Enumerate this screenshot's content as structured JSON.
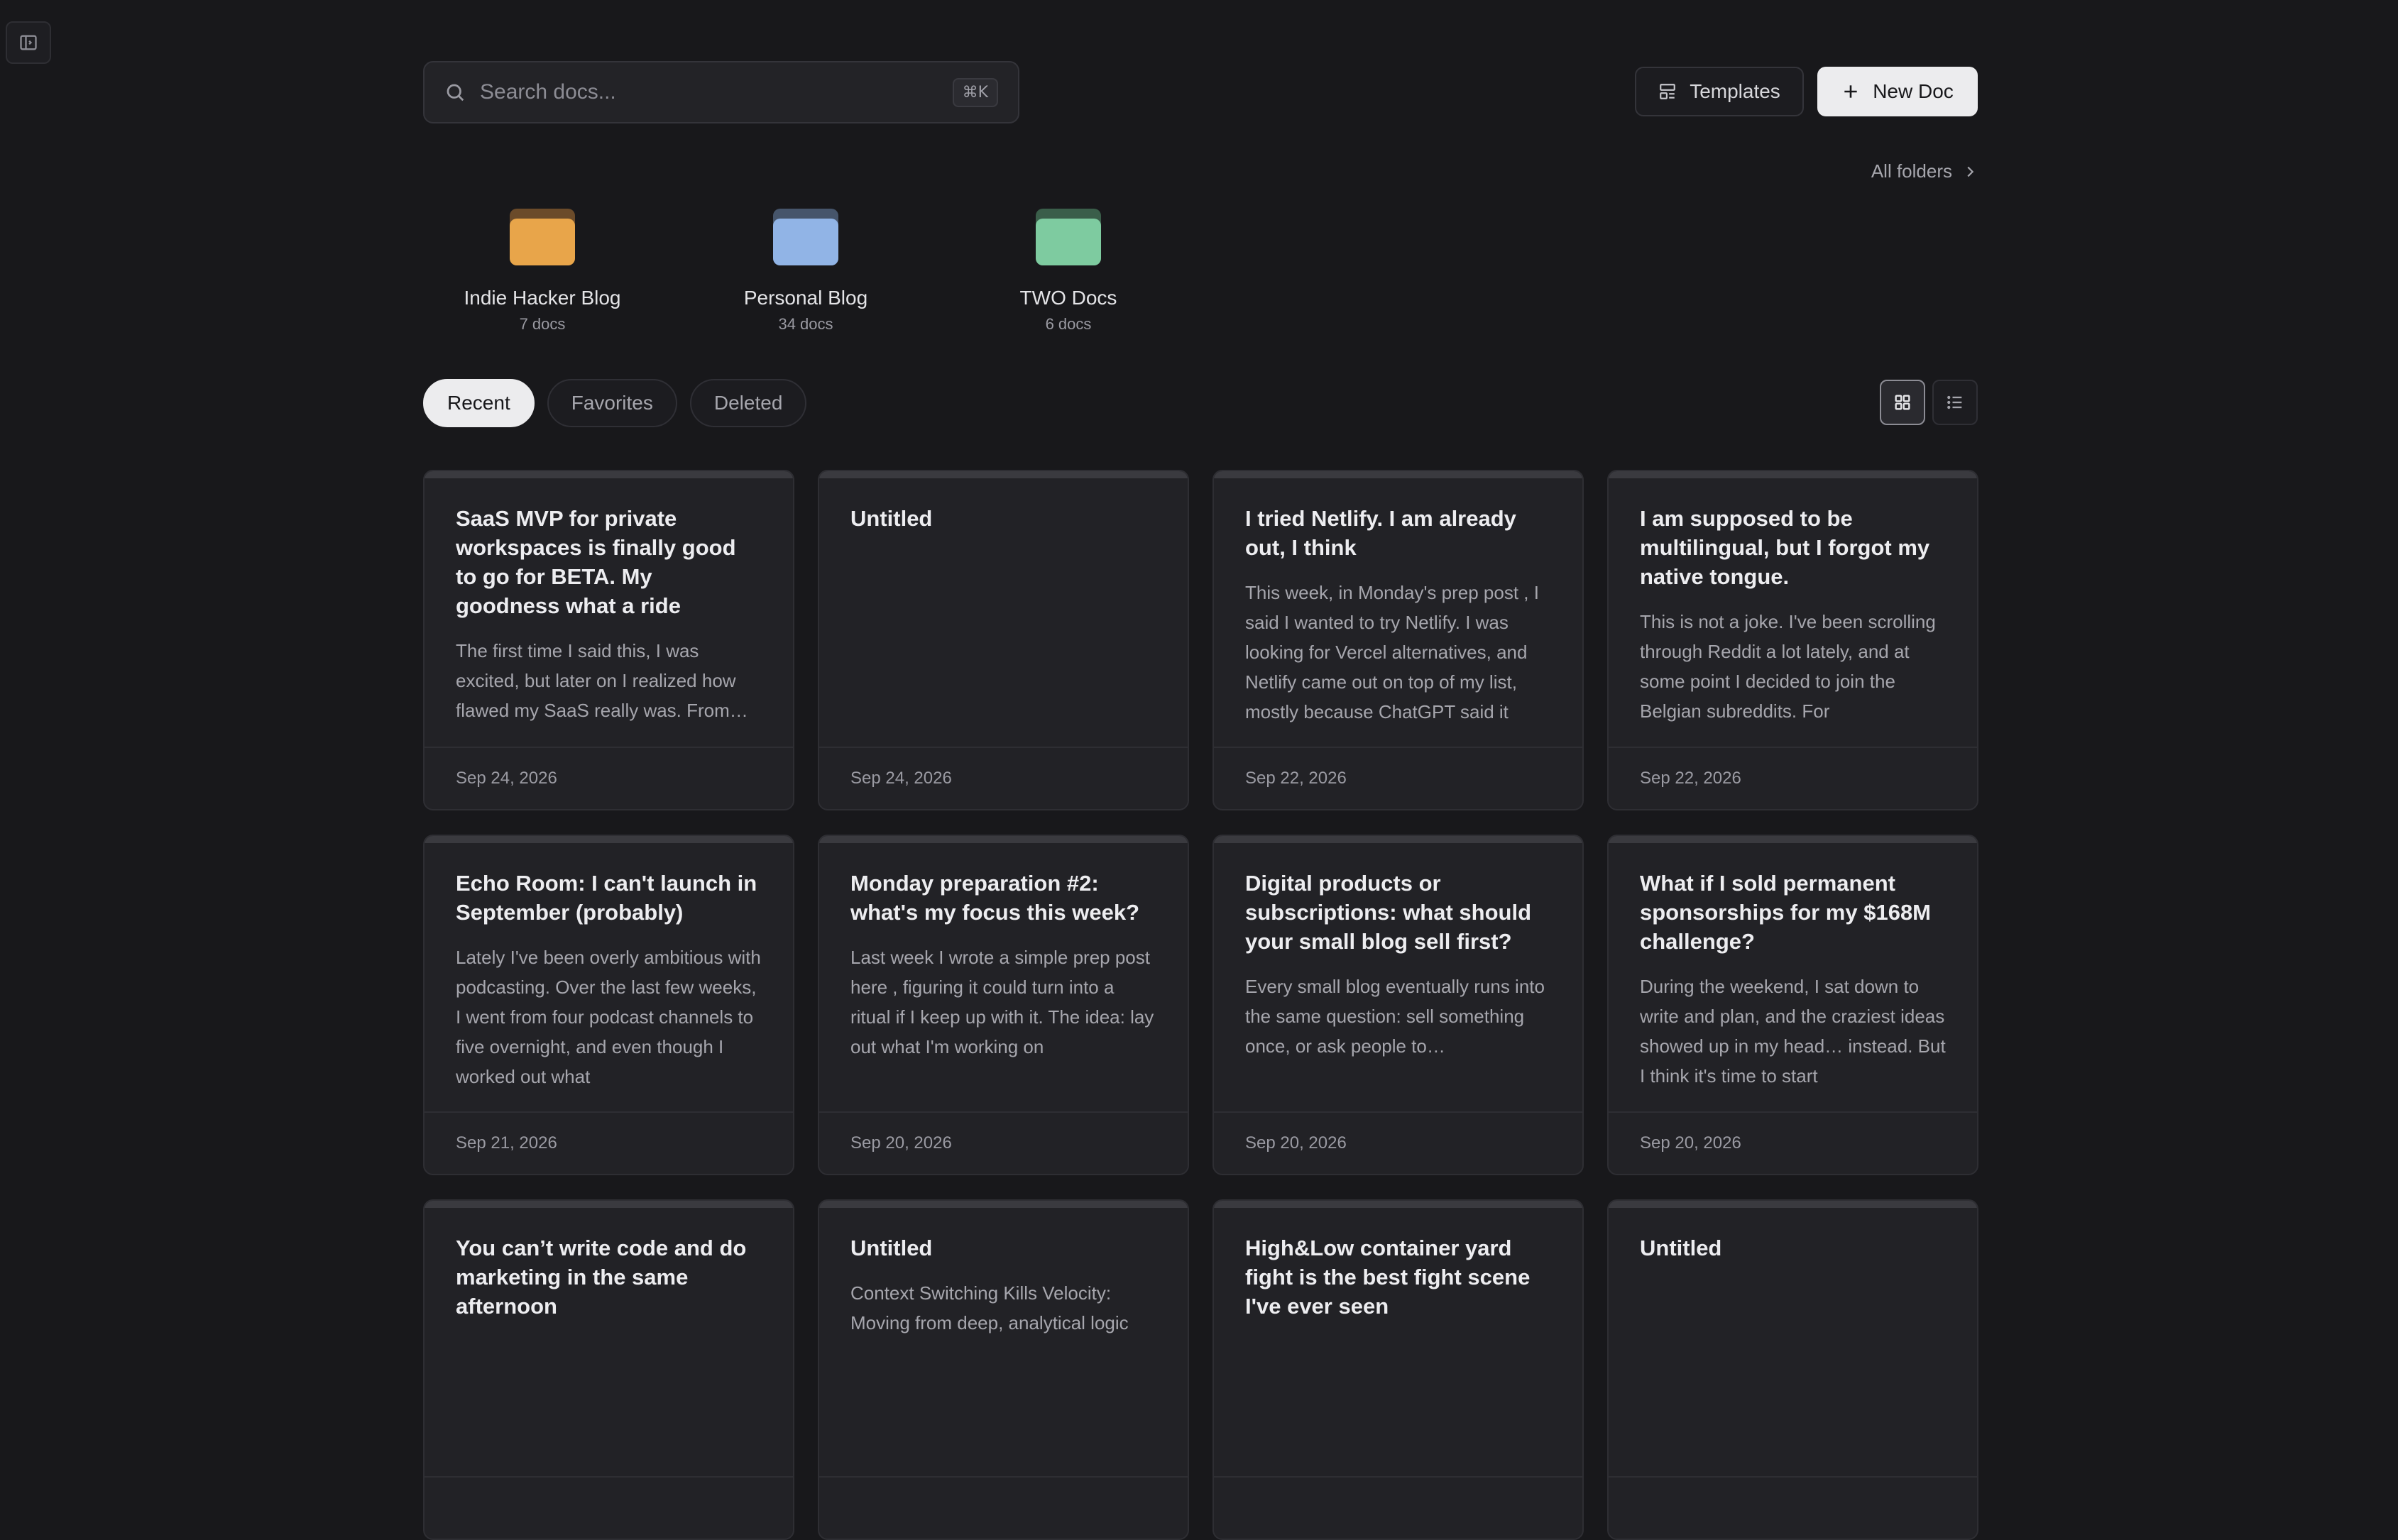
{
  "search": {
    "placeholder": "Search docs...",
    "shortcut": "⌘K"
  },
  "header": {
    "templates_label": "Templates",
    "new_doc_label": "New Doc"
  },
  "folders_link": "All folders",
  "folders": [
    {
      "name": "Indie Hacker Blog",
      "count": "7 docs",
      "color": "#e8a54a",
      "back_color": "#6b4b2a"
    },
    {
      "name": "Personal Blog",
      "count": "34 docs",
      "color": "#91b4e6",
      "back_color": "#46556b"
    },
    {
      "name": "TWO Docs",
      "count": "6 docs",
      "color": "#7ecba0",
      "back_color": "#3a5e4a"
    }
  ],
  "tabs": [
    {
      "label": "Recent",
      "active": true
    },
    {
      "label": "Favorites",
      "active": false
    },
    {
      "label": "Deleted",
      "active": false
    }
  ],
  "cards": [
    {
      "title": "SaaS MVP for private workspaces is finally good to go for BETA. My goodness what a ride",
      "excerpt": "The first time I said this, I was excited, but later on I realized how flawed my SaaS really was. From there…",
      "date": "Sep 24, 2026"
    },
    {
      "title": "Untitled",
      "excerpt": "",
      "date": "Sep 24, 2026"
    },
    {
      "title": "I tried Netlify. I am already out, I think",
      "excerpt": "This week, in Monday's prep post , I said I wanted to try Netlify. I was looking for Vercel alternatives, and Netlify came out on top of my list, mostly because ChatGPT said it",
      "date": "Sep 22, 2026"
    },
    {
      "title": "I am supposed to be multilingual, but I forgot my native tongue.",
      "excerpt": "This is not a joke. I've been scrolling through Reddit a lot lately, and at some point I decided to join the Belgian subreddits. For",
      "date": "Sep 22, 2026"
    },
    {
      "title": "Echo Room: I can't launch in September (probably)",
      "excerpt": "Lately I've been overly ambitious with podcasting. Over the last few weeks, I went from four podcast channels to five overnight, and even though I worked out what",
      "date": "Sep 21, 2026"
    },
    {
      "title": "Monday preparation #2: what's my focus this week?",
      "excerpt": "Last week I wrote a simple prep post here , figuring it could turn into a ritual if I keep up with it. The idea: lay out what I'm working on",
      "date": "Sep 20, 2026"
    },
    {
      "title": "Digital products or subscriptions: what should your small blog sell first?",
      "excerpt": "Every small blog eventually runs into the same question: sell something once, or ask people to…",
      "date": "Sep 20, 2026"
    },
    {
      "title": "What if I sold permanent sponsorships for my $168M challenge?",
      "excerpt": "During the weekend, I sat down to write and plan, and the craziest ideas showed up in my head… instead. But I think it's time to start",
      "date": "Sep 20, 2026"
    },
    {
      "title": "You can’t write code and do marketing in the same afternoon",
      "excerpt": "",
      "date": ""
    },
    {
      "title": "Untitled",
      "excerpt": "Context Switching Kills Velocity: Moving from deep, analytical logic",
      "date": ""
    },
    {
      "title": "High&Low container yard fight is the best fight scene I've ever seen",
      "excerpt": "",
      "date": ""
    },
    {
      "title": "Untitled",
      "excerpt": "",
      "date": ""
    }
  ]
}
